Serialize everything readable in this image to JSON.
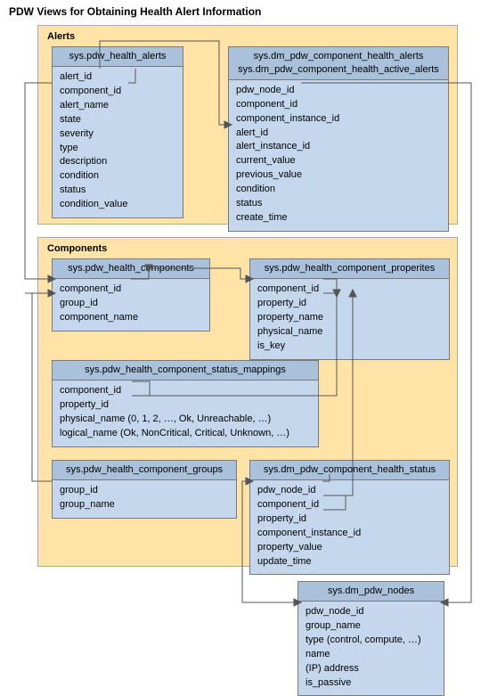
{
  "title": "PDW Views for Obtaining Health Alert Information",
  "sections": {
    "alerts": {
      "label": "Alerts"
    },
    "components": {
      "label": "Components"
    }
  },
  "entities": {
    "health_alerts": {
      "headers": [
        "sys.pdw_health_alerts"
      ],
      "cols": [
        "alert_id",
        "component_id",
        "alert_name",
        "state",
        "severity",
        "type",
        "description",
        "condition",
        "status",
        "condition_value"
      ]
    },
    "comp_health_alerts": {
      "headers": [
        "sys.dm_pdw_component_health_alerts",
        "sys.dm_pdw_component_health_active_alerts"
      ],
      "cols": [
        "pdw_node_id",
        "component_id",
        "component_instance_id",
        "alert_id",
        "alert_instance_id",
        "current_value",
        "previous_value",
        "condition",
        "status",
        "create_time"
      ]
    },
    "health_components": {
      "headers": [
        "sys.pdw_health_components"
      ],
      "cols": [
        "component_id",
        "group_id",
        "component_name"
      ]
    },
    "health_component_properties": {
      "headers": [
        "sys.pdw_health_component_properites"
      ],
      "cols": [
        "component_id",
        "property_id",
        "property_name",
        "physical_name",
        "is_key"
      ]
    },
    "status_mappings": {
      "headers": [
        "sys.pdw_health_component_status_mappings"
      ],
      "cols": [
        "component_id",
        "property_id",
        "physical_name (0, 1, 2, …, Ok, Unreachable, …)",
        "logical_name (Ok, NonCritical, Critical, Unknown, …)"
      ]
    },
    "component_groups": {
      "headers": [
        "sys.pdw_health_component_groups"
      ],
      "cols": [
        "group_id",
        "group_name"
      ]
    },
    "component_health_status": {
      "headers": [
        "sys.dm_pdw_component_health_status"
      ],
      "cols": [
        "pdw_node_id",
        "component_id",
        "property_id",
        "component_instance_id",
        "property_value",
        "update_time"
      ]
    },
    "pdw_nodes": {
      "headers": [
        "sys.dm_pdw_nodes"
      ],
      "cols": [
        "pdw_node_id",
        "group_name",
        "type (control, compute, …)",
        "name",
        "(IP) address",
        "is_passive"
      ]
    }
  }
}
